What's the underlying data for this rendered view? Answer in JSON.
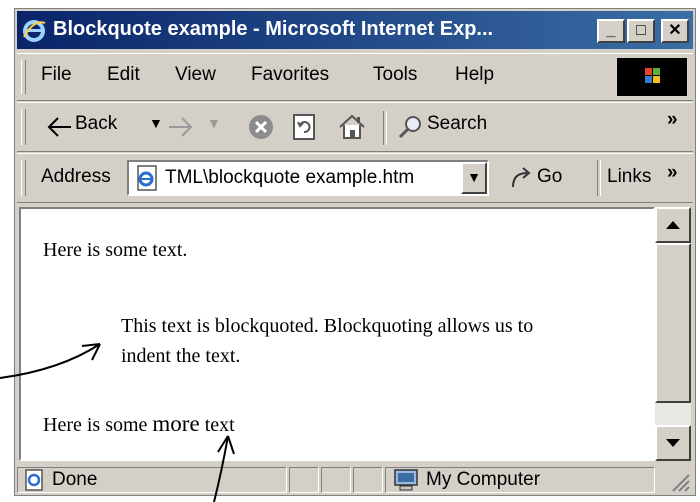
{
  "window": {
    "title": "Blockquote example - Microsoft Internet Exp..."
  },
  "title_buttons": {
    "minimize": "_",
    "maximize": "□",
    "close": "✕"
  },
  "menu": [
    {
      "label": "File"
    },
    {
      "label": "Edit"
    },
    {
      "label": "View"
    },
    {
      "label": "Favorites"
    },
    {
      "label": "Tools"
    },
    {
      "label": "Help"
    }
  ],
  "toolbar": {
    "back_label": "Back",
    "search_label": "Search",
    "overflow": "»"
  },
  "address_bar": {
    "label": "Address",
    "value": "TML\\blockquote example.htm",
    "go_label": "Go",
    "links_label": "Links",
    "links_overflow": "»"
  },
  "page": {
    "para1": "Here is some text.",
    "blockquote": "This text is blockquoted.   Blockquoting allows us to indent the text.",
    "para2_prefix": "Here is some ",
    "para2_emph": "more",
    "para2_suffix": " text"
  },
  "status": {
    "text": "Done",
    "zone": "My Computer"
  }
}
